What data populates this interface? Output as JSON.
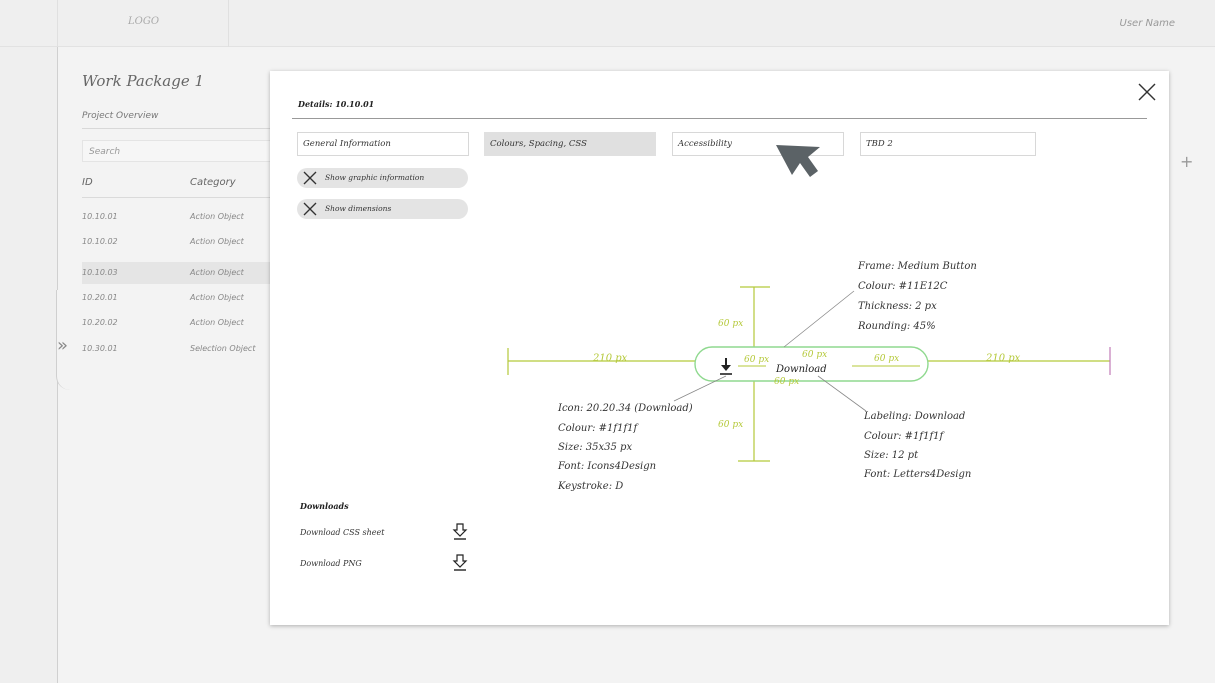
{
  "header": {
    "logo": "LOGO",
    "user_name": "User Name"
  },
  "work_package": {
    "title": "Work Package 1",
    "subtitle": "Project Overview",
    "search_placeholder": "Search",
    "columns": [
      "ID",
      "Category"
    ],
    "rows": [
      {
        "id": "10.10.01",
        "category": "Action Object"
      },
      {
        "id": "10.10.02",
        "category": "Action Object"
      },
      {
        "id": "10.10.03",
        "category": "Action Object"
      },
      {
        "id": "10.20.01",
        "category": "Action Object"
      },
      {
        "id": "10.20.02",
        "category": "Action Object"
      },
      {
        "id": "10.30.01",
        "category": "Selection Object"
      }
    ]
  },
  "modal": {
    "title": "Details: 10.10.01",
    "tabs": [
      "General Information",
      "Colours, Spacing, CSS",
      "Accessibility",
      "TBD 2"
    ],
    "active_tab": "Colours, Spacing, CSS",
    "toggles": [
      "Show graphic information",
      "Show dimensions"
    ],
    "downloads": {
      "title": "Downloads",
      "items": [
        "Download CSS sheet",
        "Download PNG"
      ]
    }
  },
  "diagram": {
    "button_label": "Download",
    "dim_left": "210 px",
    "dim_right": "210 px",
    "dim_top": "60 px",
    "dim_bottom": "60 px",
    "dim_inner_left": "60 px",
    "dim_inner_right": "60 px",
    "dim_label_top": "60 px",
    "dim_label_bottom": "60 px",
    "frame_notes": [
      "Frame: Medium Button",
      "Colour: #11E12C",
      "Thickness: 2 px",
      "Rounding: 45%"
    ],
    "icon_notes": [
      "Icon: 20.20.34 (Download)",
      "Colour: #1f1f1f",
      "Size: 35x35 px",
      "Font: Icons4Design",
      "Keystroke: D"
    ],
    "label_notes": [
      "Labeling: Download",
      "Colour: #1f1f1f",
      "Size: 12 pt",
      "Font: Letters4Design"
    ]
  },
  "colors": {
    "frame": "#8fd98f",
    "dimension": "#b5c93a",
    "end_marker": "#c27ab8",
    "cursor": "#5b6266"
  }
}
